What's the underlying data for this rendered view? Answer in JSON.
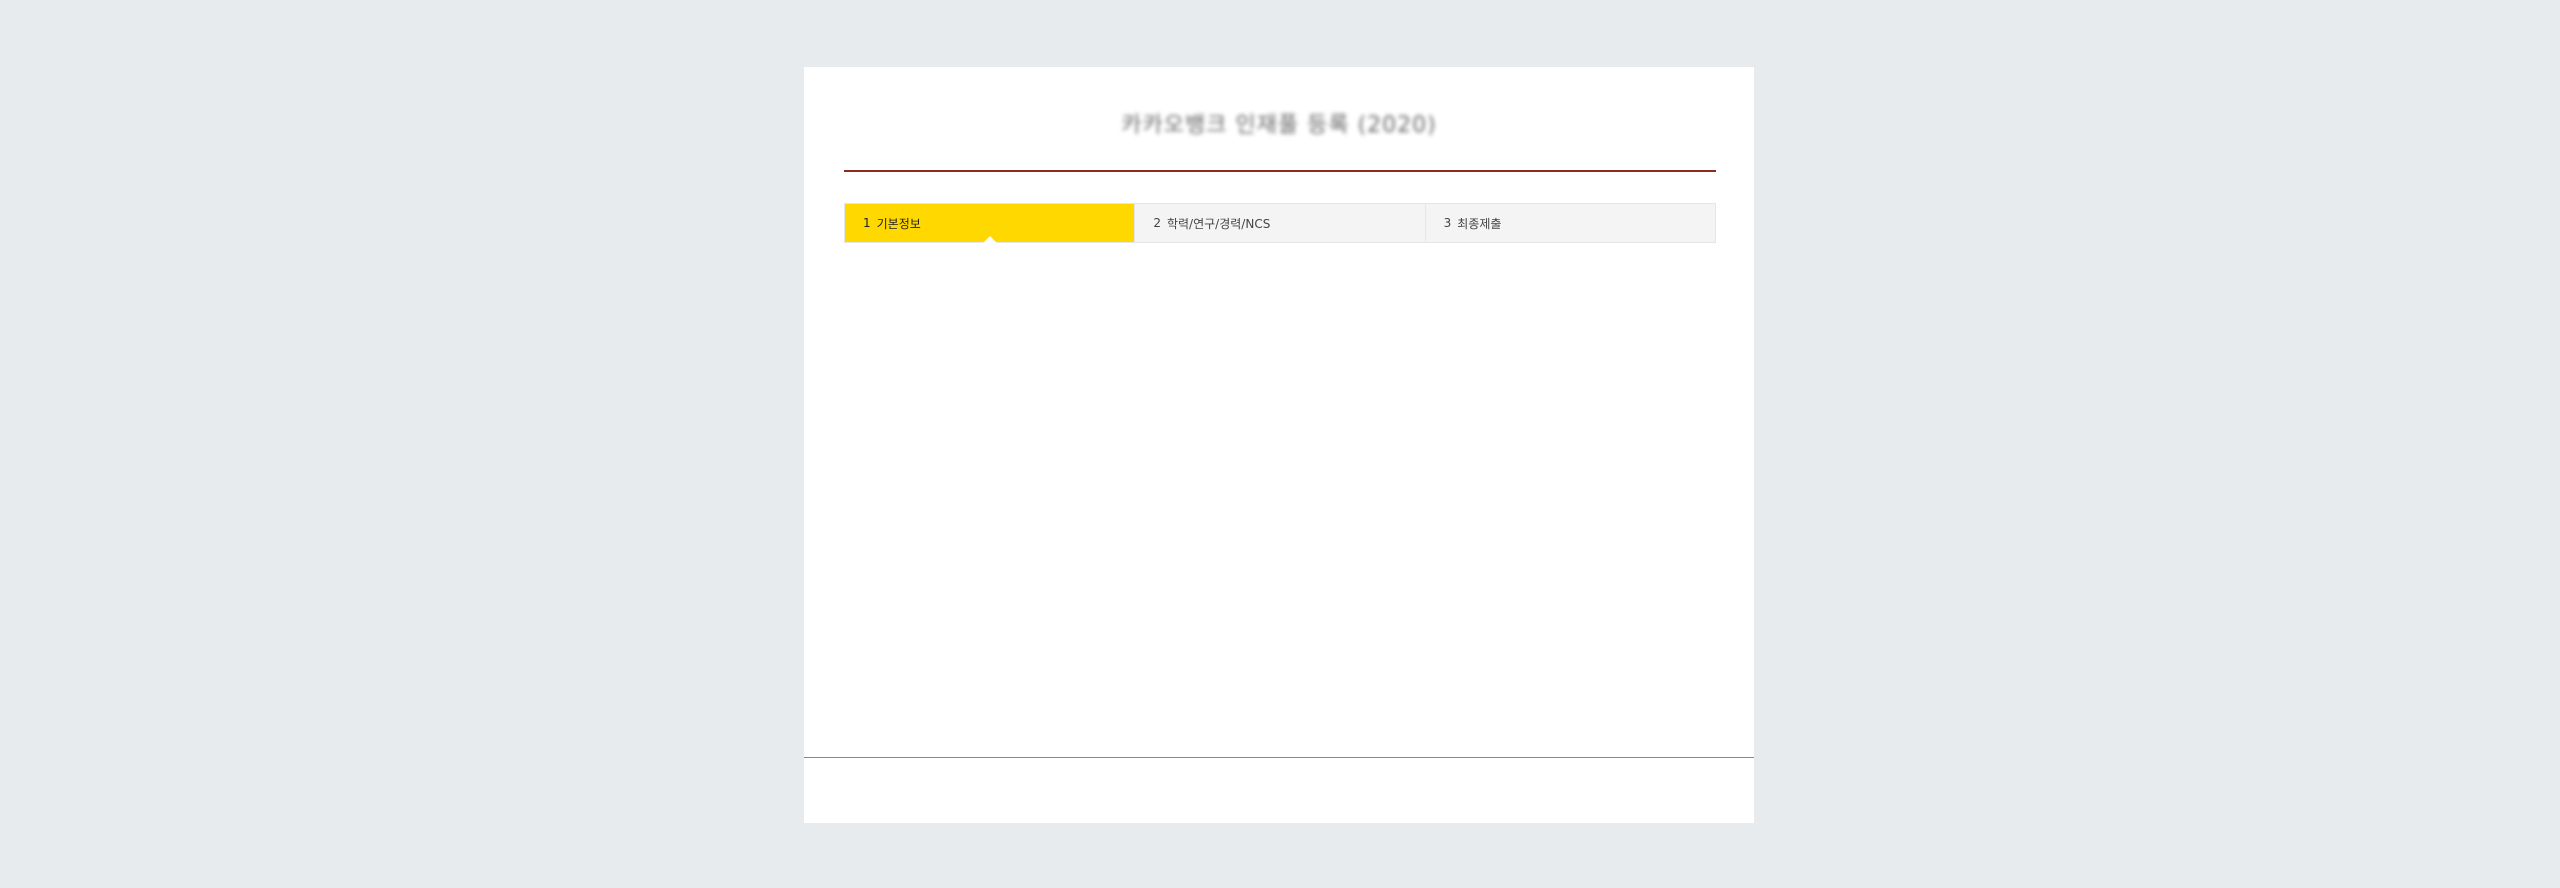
{
  "header": {
    "title": "카카오뱅크 인재풀 등록 (2020)"
  },
  "steps": [
    {
      "number": "1",
      "label": "기본정보",
      "active": true
    },
    {
      "number": "2",
      "label": "학력/연구/경력/NCS",
      "active": false
    },
    {
      "number": "3",
      "label": "최종제출",
      "active": false
    }
  ],
  "colors": {
    "accent": "#ffd800",
    "title_rule": "#8b2a22",
    "background": "#e8ebee"
  }
}
